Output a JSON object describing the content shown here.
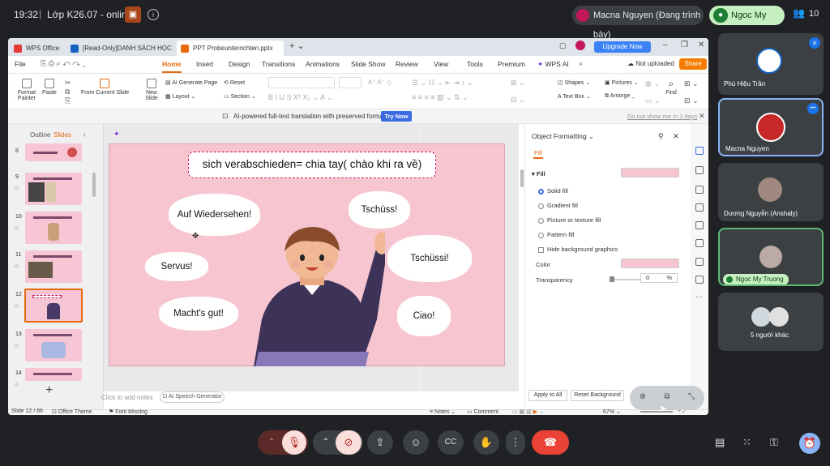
{
  "meet": {
    "time": "19:32",
    "meeting_title": "Lớp K26.07 - online",
    "presenter_label": "Macna Nguyen (Đang trình bày)",
    "active_speaker": "Ngoc My Truong",
    "participant_count": "10"
  },
  "wps": {
    "tabs": [
      "WPS Office",
      "[Read-Only]DANH SÁCH HỌC VI",
      "PPT Probeunterrichten.pptx"
    ],
    "upgrade": "Upgrade Now",
    "menu": [
      "File",
      "Home",
      "Insert",
      "Design",
      "Transitions",
      "Animations",
      "Slide Show",
      "Review",
      "View",
      "Tools",
      "Premium",
      "WPS AI"
    ],
    "not_uploaded": "Not uploaded",
    "share": "Share",
    "ribbon": {
      "format_painter_1": "Format",
      "format_painter_2": "Painter",
      "paste": "Paste",
      "from_current_slide": "From Current Slide",
      "new_slide_1": "New",
      "new_slide_2": "Slide",
      "ai_generate": "AI Generate Page",
      "layout": "Layout",
      "reset": "Reset",
      "section": "Section",
      "shapes": "Shapes",
      "text_box": "Text Box",
      "pictures": "Pictures",
      "arrange": "Arrange",
      "find": "Find"
    },
    "ai_bar": {
      "text": "AI-powered full-text translation with preserved formatting",
      "try_now": "Try Now",
      "dont_show": "Do not show me in 3 days"
    },
    "panel_tabs": [
      "Outline",
      "Slides"
    ],
    "thumbs": [
      "8",
      "9",
      "10",
      "11",
      "12",
      "13",
      "14"
    ],
    "slide": {
      "title": "sich verabschieden= chia tay( chào khi ra về)",
      "bubbles": [
        "Auf  Wiedersehen!",
        "Tschüss!",
        "Servus!",
        "Tschüssi!",
        "Macht's gut!",
        "Ciao!"
      ]
    },
    "notes": "Click to add notes",
    "ai_speech": "AI Speech Generator",
    "status": {
      "slide": "Slide 12 / 66",
      "theme": "Office Theme",
      "font": "Font Missing",
      "notes": "Notes",
      "comment": "Comment",
      "zoom": "67%"
    },
    "format_panel": {
      "title": "Object Formatting",
      "tab": "Fill",
      "section": "Fill",
      "options": [
        "Solid fill",
        "Gradient fill",
        "Picture or texture fill",
        "Pattern fill"
      ],
      "hide_bg": "Hide background graphics",
      "color": "Color",
      "transparency": "Transparency",
      "transparency_value": "0",
      "percent": "%",
      "apply_all": "Apply to All",
      "reset_bg": "Reset Background"
    }
  },
  "participants": [
    {
      "name": "Phú Hiệu Trần"
    },
    {
      "name": "Macna Nguyen"
    },
    {
      "name": "Dương Nguyễn (Anshaly)"
    },
    {
      "name": "Ngoc My Truong"
    },
    {
      "name": "5 người khác"
    }
  ],
  "colors": {
    "meet_bg": "#202124",
    "slide_pink": "#f7c5d0",
    "wps_orange": "#e8690c",
    "end_call": "#ea4335"
  }
}
